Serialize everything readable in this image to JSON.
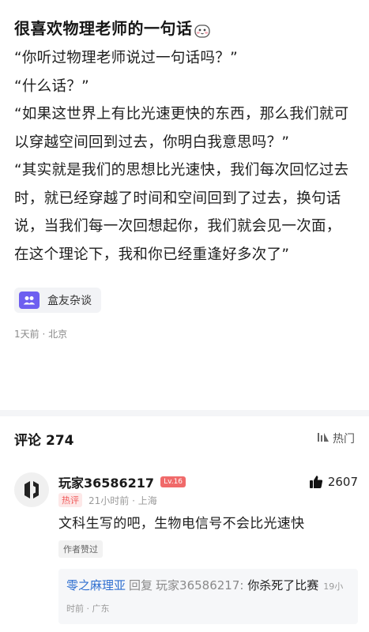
{
  "post": {
    "title": "很喜欢物理老师的一句话",
    "title_emoji": "face-emoji",
    "paragraphs": [
      "“你听过物理老师说过一句话吗？”",
      "“什么话？”",
      "“如果这世界上有比光速更快的东西，那么我们就可以穿越空间回到过去，你明白我意思吗？”",
      "“其实就是我们的思想比光速快，我们每次回忆过去时，就已经穿越了时间和空间回到了过去，换句话说，当我们每一次回想起你，我们就会见一次面，在这个理论下，我和你已经重逢好多次了”"
    ],
    "tag": "盒友杂谈",
    "meta": "1天前 · 北京"
  },
  "comments_section": {
    "title": "评论",
    "count": "274",
    "sort_label": "热门"
  },
  "comment": {
    "user": "玩家36586217",
    "level": "Lv.16",
    "likes": "2607",
    "hot_badge": "热评",
    "time_location": "21小时前 · 上海",
    "text": "文科生写的吧，生物电信号不会比光速快",
    "author_liked": "作者赞过",
    "reply": {
      "user": "零之麻理亚",
      "verb": "回复",
      "target": "玩家36586217:",
      "text": "你杀死了比赛",
      "meta": "19小时前 · 广东"
    }
  },
  "colors": {
    "accent_purple": "#6e5ff0",
    "hot_red": "#f05a5a",
    "link_blue": "#2f6fd0"
  }
}
